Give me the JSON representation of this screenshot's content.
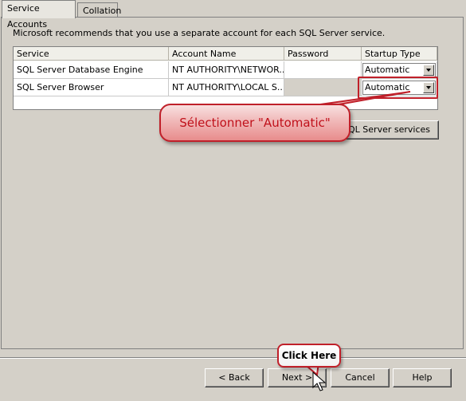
{
  "tabs": {
    "active_label": "Service Accounts",
    "inactive_label": "Collation"
  },
  "intro_text": "Microsoft recommends that you use a separate account for each SQL Server service.",
  "grid": {
    "columns": [
      "Service",
      "Account Name",
      "Password",
      "Startup Type"
    ],
    "rows": [
      {
        "service": "SQL Server Database Engine",
        "account": "NT AUTHORITY\\NETWOR...",
        "password": "",
        "startup": "Automatic"
      },
      {
        "service": "SQL Server Browser",
        "account": "NT AUTHORITY\\LOCAL S...",
        "password": "",
        "startup": "Automatic"
      }
    ]
  },
  "use_same_button": "SQL Server services",
  "annotations": {
    "callout_text": "Sélectionner \"Automatic\"",
    "click_here_text": "Click Here",
    "accent_color": "#c0202a"
  },
  "buttons": {
    "back": "< Back",
    "next": "Next >",
    "cancel": "Cancel",
    "help": "Help"
  }
}
